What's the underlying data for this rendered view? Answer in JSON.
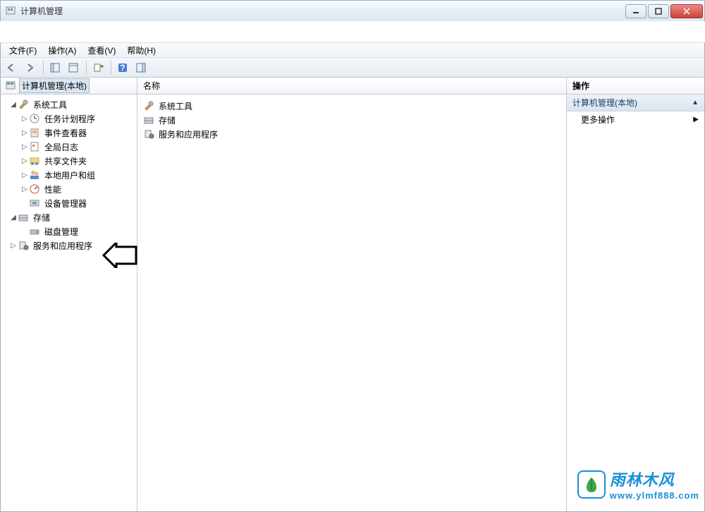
{
  "titlebar": {
    "title": "计算机管理"
  },
  "menubar": {
    "file": "文件(F)",
    "action": "操作(A)",
    "view": "查看(V)",
    "help": "帮助(H)"
  },
  "tree": {
    "root": "计算机管理(本地)",
    "system_tools": "系统工具",
    "task_scheduler": "任务计划程序",
    "event_viewer": "事件查看器",
    "global_log": "全局日志",
    "shared_folders": "共享文件夹",
    "local_users": "本地用户和组",
    "performance": "性能",
    "device_manager": "设备管理器",
    "storage": "存储",
    "disk_management": "磁盘管理",
    "services_apps": "服务和应用程序"
  },
  "list": {
    "header": "名称",
    "items": [
      "系统工具",
      "存储",
      "服务和应用程序"
    ]
  },
  "actions": {
    "header": "操作",
    "group": "计算机管理(本地)",
    "more": "更多操作"
  },
  "watermark": {
    "ch": "雨林木风",
    "url": "www.ylmf888.com"
  }
}
